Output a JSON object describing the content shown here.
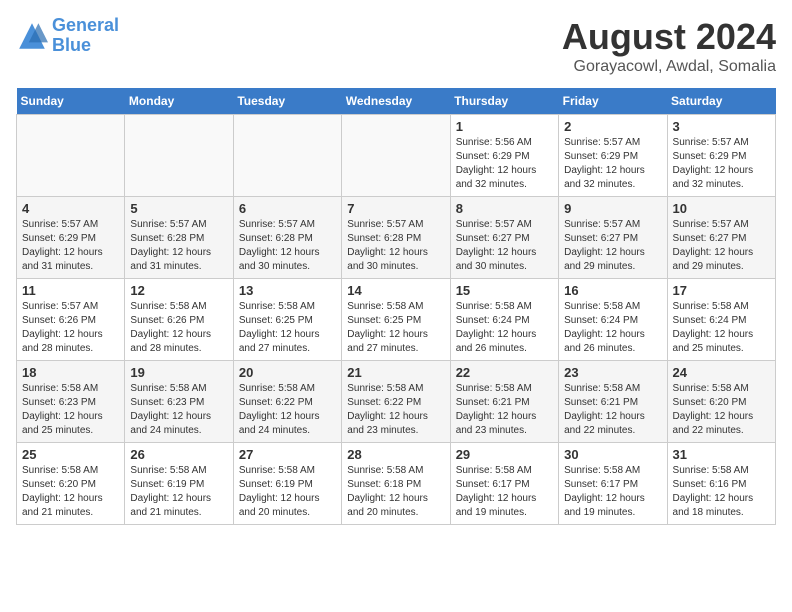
{
  "header": {
    "logo_line1": "General",
    "logo_line2": "Blue",
    "month": "August 2024",
    "location": "Gorayacowl, Awdal, Somalia"
  },
  "weekdays": [
    "Sunday",
    "Monday",
    "Tuesday",
    "Wednesday",
    "Thursday",
    "Friday",
    "Saturday"
  ],
  "weeks": [
    [
      {
        "day": "",
        "info": ""
      },
      {
        "day": "",
        "info": ""
      },
      {
        "day": "",
        "info": ""
      },
      {
        "day": "",
        "info": ""
      },
      {
        "day": "1",
        "info": "Sunrise: 5:56 AM\nSunset: 6:29 PM\nDaylight: 12 hours\nand 32 minutes."
      },
      {
        "day": "2",
        "info": "Sunrise: 5:57 AM\nSunset: 6:29 PM\nDaylight: 12 hours\nand 32 minutes."
      },
      {
        "day": "3",
        "info": "Sunrise: 5:57 AM\nSunset: 6:29 PM\nDaylight: 12 hours\nand 32 minutes."
      }
    ],
    [
      {
        "day": "4",
        "info": "Sunrise: 5:57 AM\nSunset: 6:29 PM\nDaylight: 12 hours\nand 31 minutes."
      },
      {
        "day": "5",
        "info": "Sunrise: 5:57 AM\nSunset: 6:28 PM\nDaylight: 12 hours\nand 31 minutes."
      },
      {
        "day": "6",
        "info": "Sunrise: 5:57 AM\nSunset: 6:28 PM\nDaylight: 12 hours\nand 30 minutes."
      },
      {
        "day": "7",
        "info": "Sunrise: 5:57 AM\nSunset: 6:28 PM\nDaylight: 12 hours\nand 30 minutes."
      },
      {
        "day": "8",
        "info": "Sunrise: 5:57 AM\nSunset: 6:27 PM\nDaylight: 12 hours\nand 30 minutes."
      },
      {
        "day": "9",
        "info": "Sunrise: 5:57 AM\nSunset: 6:27 PM\nDaylight: 12 hours\nand 29 minutes."
      },
      {
        "day": "10",
        "info": "Sunrise: 5:57 AM\nSunset: 6:27 PM\nDaylight: 12 hours\nand 29 minutes."
      }
    ],
    [
      {
        "day": "11",
        "info": "Sunrise: 5:57 AM\nSunset: 6:26 PM\nDaylight: 12 hours\nand 28 minutes."
      },
      {
        "day": "12",
        "info": "Sunrise: 5:58 AM\nSunset: 6:26 PM\nDaylight: 12 hours\nand 28 minutes."
      },
      {
        "day": "13",
        "info": "Sunrise: 5:58 AM\nSunset: 6:25 PM\nDaylight: 12 hours\nand 27 minutes."
      },
      {
        "day": "14",
        "info": "Sunrise: 5:58 AM\nSunset: 6:25 PM\nDaylight: 12 hours\nand 27 minutes."
      },
      {
        "day": "15",
        "info": "Sunrise: 5:58 AM\nSunset: 6:24 PM\nDaylight: 12 hours\nand 26 minutes."
      },
      {
        "day": "16",
        "info": "Sunrise: 5:58 AM\nSunset: 6:24 PM\nDaylight: 12 hours\nand 26 minutes."
      },
      {
        "day": "17",
        "info": "Sunrise: 5:58 AM\nSunset: 6:24 PM\nDaylight: 12 hours\nand 25 minutes."
      }
    ],
    [
      {
        "day": "18",
        "info": "Sunrise: 5:58 AM\nSunset: 6:23 PM\nDaylight: 12 hours\nand 25 minutes."
      },
      {
        "day": "19",
        "info": "Sunrise: 5:58 AM\nSunset: 6:23 PM\nDaylight: 12 hours\nand 24 minutes."
      },
      {
        "day": "20",
        "info": "Sunrise: 5:58 AM\nSunset: 6:22 PM\nDaylight: 12 hours\nand 24 minutes."
      },
      {
        "day": "21",
        "info": "Sunrise: 5:58 AM\nSunset: 6:22 PM\nDaylight: 12 hours\nand 23 minutes."
      },
      {
        "day": "22",
        "info": "Sunrise: 5:58 AM\nSunset: 6:21 PM\nDaylight: 12 hours\nand 23 minutes."
      },
      {
        "day": "23",
        "info": "Sunrise: 5:58 AM\nSunset: 6:21 PM\nDaylight: 12 hours\nand 22 minutes."
      },
      {
        "day": "24",
        "info": "Sunrise: 5:58 AM\nSunset: 6:20 PM\nDaylight: 12 hours\nand 22 minutes."
      }
    ],
    [
      {
        "day": "25",
        "info": "Sunrise: 5:58 AM\nSunset: 6:20 PM\nDaylight: 12 hours\nand 21 minutes."
      },
      {
        "day": "26",
        "info": "Sunrise: 5:58 AM\nSunset: 6:19 PM\nDaylight: 12 hours\nand 21 minutes."
      },
      {
        "day": "27",
        "info": "Sunrise: 5:58 AM\nSunset: 6:19 PM\nDaylight: 12 hours\nand 20 minutes."
      },
      {
        "day": "28",
        "info": "Sunrise: 5:58 AM\nSunset: 6:18 PM\nDaylight: 12 hours\nand 20 minutes."
      },
      {
        "day": "29",
        "info": "Sunrise: 5:58 AM\nSunset: 6:17 PM\nDaylight: 12 hours\nand 19 minutes."
      },
      {
        "day": "30",
        "info": "Sunrise: 5:58 AM\nSunset: 6:17 PM\nDaylight: 12 hours\nand 19 minutes."
      },
      {
        "day": "31",
        "info": "Sunrise: 5:58 AM\nSunset: 6:16 PM\nDaylight: 12 hours\nand 18 minutes."
      }
    ]
  ]
}
